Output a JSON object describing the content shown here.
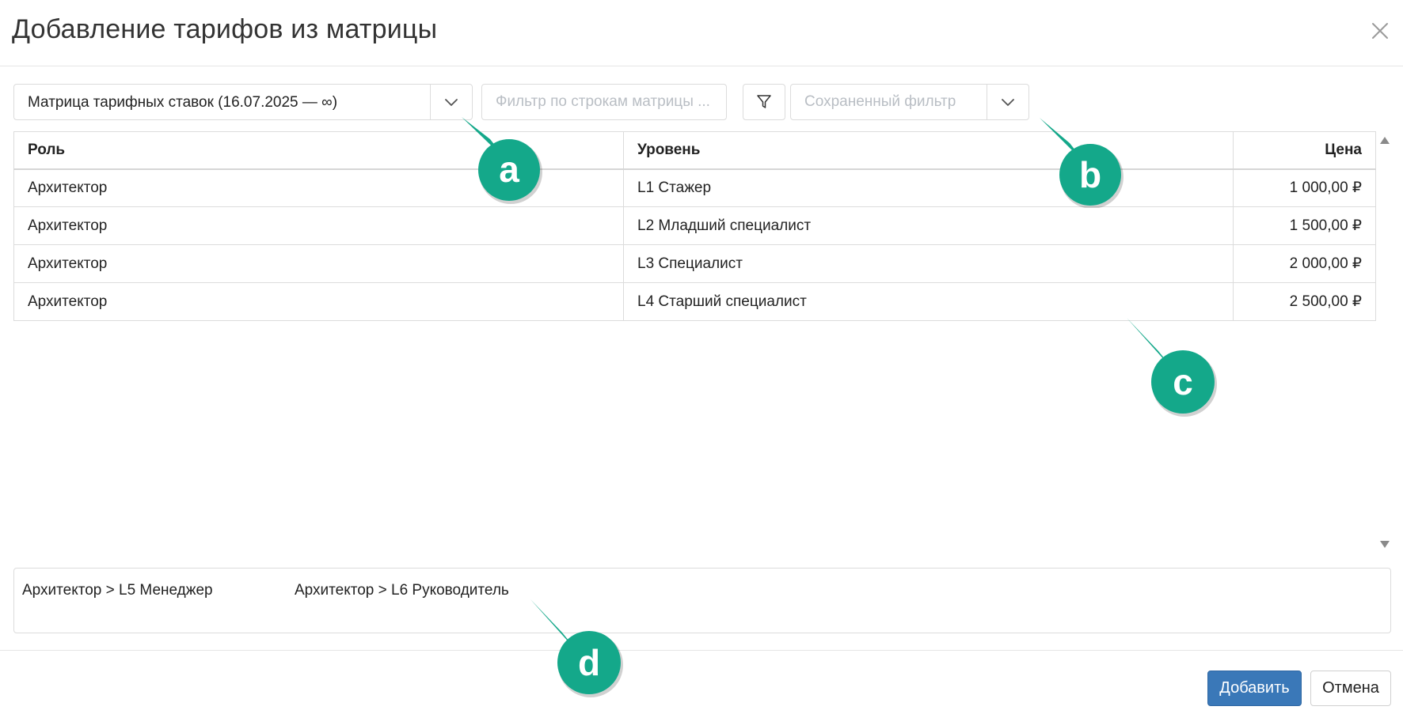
{
  "dialog": {
    "title": "Добавление тарифов из матрицы"
  },
  "toolbar": {
    "matrix_select_value": "Матрица тарифных ставок (16.07.2025 — ∞)",
    "row_filter_placeholder": "Фильтр по строкам матрицы ...",
    "saved_filter_placeholder": "Сохраненный фильтр"
  },
  "table": {
    "columns": [
      "Роль",
      "Уровень",
      "Цена"
    ],
    "rows": [
      {
        "role": "Архитектор",
        "level": "L1 Стажер",
        "price": "1 000,00 ₽"
      },
      {
        "role": "Архитектор",
        "level": "L2 Младший специалист",
        "price": "1 500,00 ₽"
      },
      {
        "role": "Архитектор",
        "level": "L3 Специалист",
        "price": "2 000,00 ₽"
      },
      {
        "role": "Архитектор",
        "level": "L4 Старший специалист",
        "price": "2 500,00 ₽"
      }
    ]
  },
  "selection": {
    "items": [
      "Архитектор > L5 Менеджер",
      "Архитектор > L6 Руководитель"
    ]
  },
  "footer": {
    "add_label": "Добавить",
    "cancel_label": "Отмена"
  },
  "callouts": [
    "a",
    "b",
    "c",
    "d"
  ],
  "colors": {
    "callout": "#14a88a",
    "primary": "#3a78b8",
    "border": "#dcdcdc",
    "placeholder": "#b9bec4"
  },
  "icons": {
    "close": "close-icon",
    "dropdown": "chevron-down-icon",
    "filter": "filter-icon",
    "scroll_up": "scroll-up-icon",
    "scroll_down": "scroll-down-icon"
  }
}
